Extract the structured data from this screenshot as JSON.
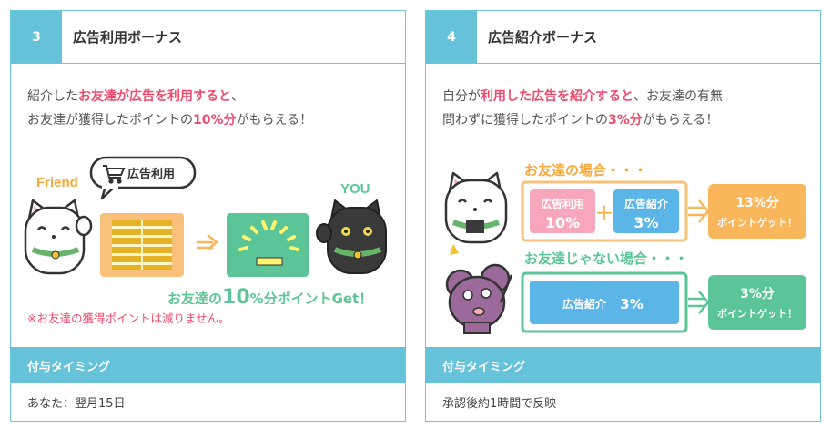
{
  "cards": [
    {
      "number": "3",
      "title": "広告利用ボーナス",
      "desc": {
        "l1a": "紹介した",
        "l1b": "お友達が広告を利用すると",
        "l1c": "、",
        "l2a": "お友達が獲得したポイントの",
        "l2b": "10%分",
        "l2c": "がもらえる！"
      },
      "illustration": {
        "friend_label": "Friend",
        "bubble": "広告利用",
        "you_label": "YOU",
        "caption_a": "お友達の",
        "caption_b": "10",
        "caption_c": "%分ポイントGet",
        "caption_d": "！"
      },
      "note": "※お友達の獲得ポイントは減りません。",
      "timing_label": "付与タイミング",
      "timing_value": "あなた：翌月15日"
    },
    {
      "number": "4",
      "title": "広告紹介ボーナス",
      "desc": {
        "l1a": "自分が",
        "l1b": "利用した広告を紹介すると",
        "l1c": "、お友達の有無",
        "l2a": "問わずに獲得したポイントの",
        "l2b": "3%分",
        "l2c": "がもらえる！"
      },
      "illustration": {
        "case1_title": "お友達の場合・・・",
        "box1_label": "広告利用",
        "box1_value": "10%",
        "plus": "＋",
        "box2_label": "広告紹介",
        "box2_value": "3%",
        "result1_value": "13%分",
        "result1_text": "ポイントゲット！",
        "case2_title": "お友達じゃない場合・・・",
        "box3_label": "広告紹介",
        "box3_value": "3%",
        "result2_value": "3%分",
        "result2_text": "ポイントゲット！"
      },
      "timing_label": "付与タイミング",
      "timing_value": "承認後約1時間で反映"
    }
  ],
  "colors": {
    "accent": "#66c2d9",
    "highlight": "#ef4a6d",
    "green": "#5cc598",
    "orange": "#f9b65a",
    "blue": "#5bb5e6",
    "purple": "#9b6a9a"
  }
}
